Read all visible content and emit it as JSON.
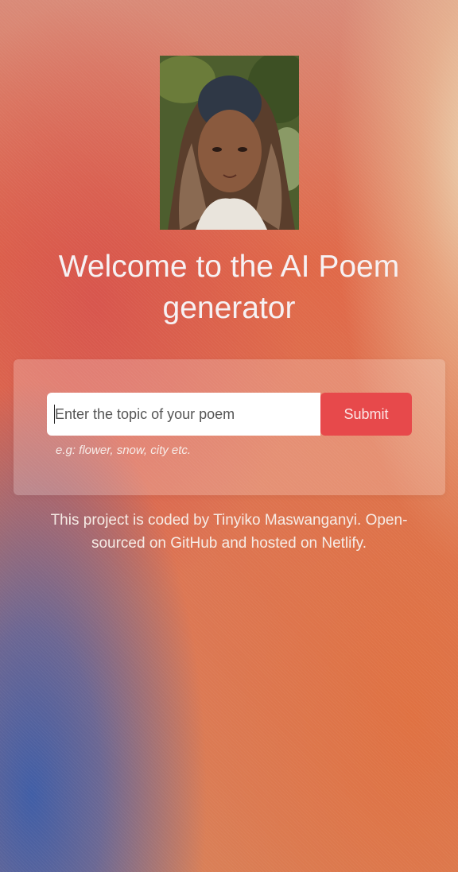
{
  "header": {
    "avatar_alt": "Profile photo",
    "title": "Welcome to the AI Poem generator"
  },
  "form": {
    "input_placeholder": "Enter the topic of your poem",
    "input_value": "",
    "submit_label": "Submit",
    "hint": "e.g: flower, snow, city etc."
  },
  "footer": {
    "text": "This project is coded by Tinyiko Maswanganyi. Open-sourced on GitHub and hosted on Netlify."
  },
  "colors": {
    "accent": "#e7494b"
  }
}
